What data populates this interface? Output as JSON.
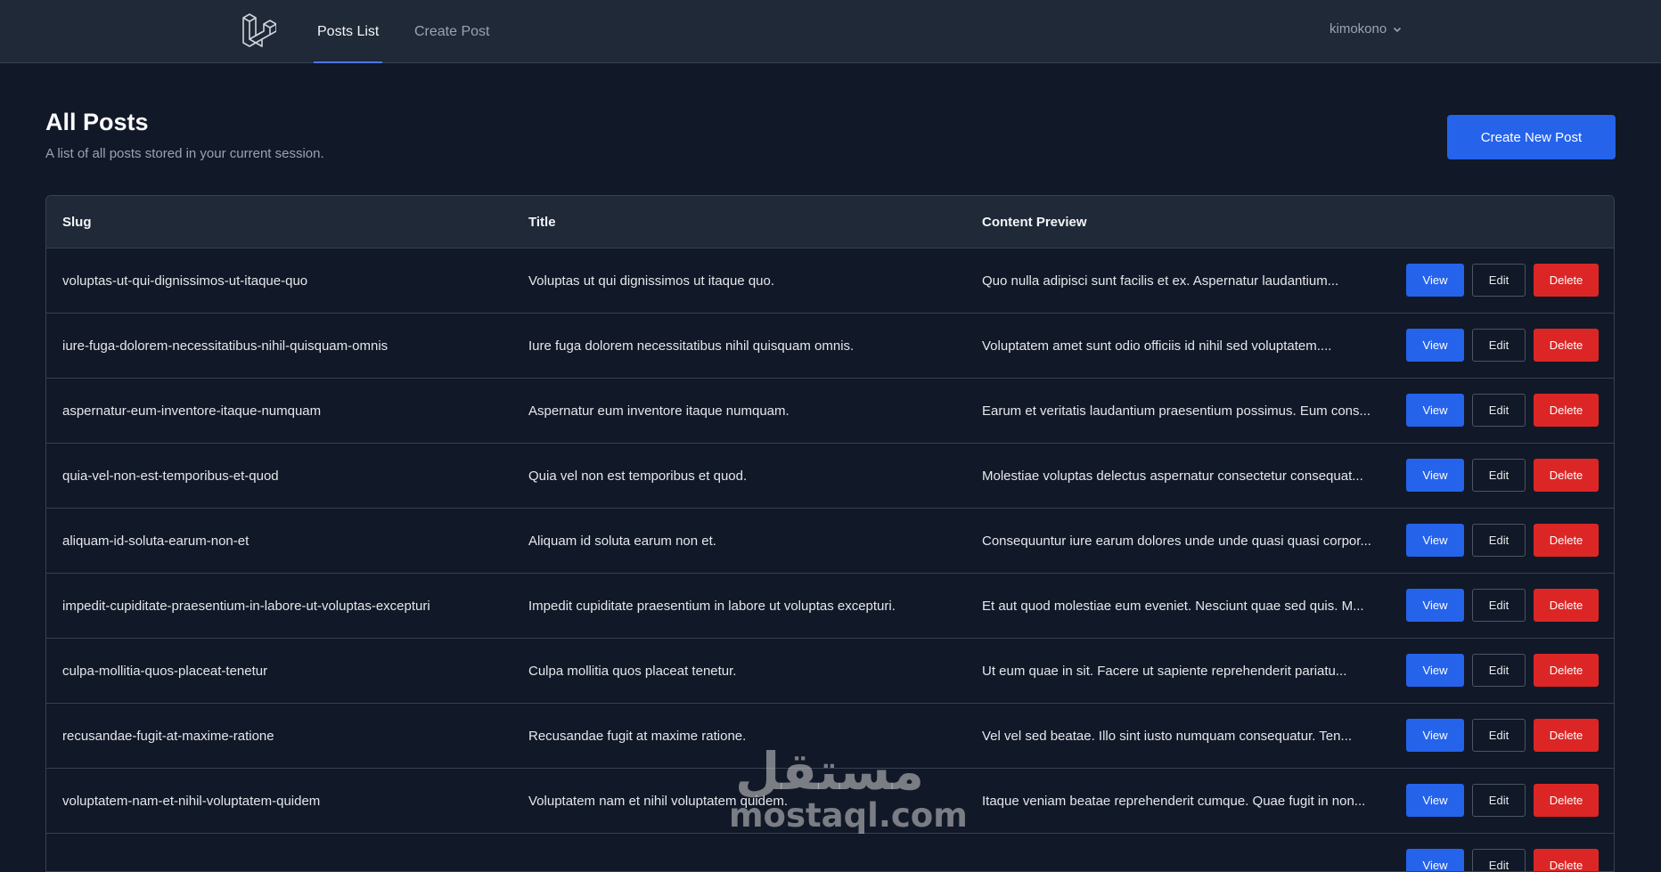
{
  "nav": {
    "tabs": [
      {
        "label": "Posts List"
      },
      {
        "label": "Create Post"
      }
    ],
    "user": "kimokono"
  },
  "header": {
    "title": "All Posts",
    "subtitle": "A list of all posts stored in your current session.",
    "create_button": "Create New Post"
  },
  "table": {
    "columns": [
      "Slug",
      "Title",
      "Content Preview"
    ],
    "actions": {
      "view": "View",
      "edit": "Edit",
      "delete": "Delete"
    },
    "rows": [
      {
        "slug": "voluptas-ut-qui-dignissimos-ut-itaque-quo",
        "title": "Voluptas ut qui dignissimos ut itaque quo.",
        "content": "Quo nulla adipisci sunt facilis et ex. Aspernatur laudantium..."
      },
      {
        "slug": "iure-fuga-dolorem-necessitatibus-nihil-quisquam-omnis",
        "title": "Iure fuga dolorem necessitatibus nihil quisquam omnis.",
        "content": "Voluptatem amet sunt odio officiis id nihil sed voluptatem...."
      },
      {
        "slug": "aspernatur-eum-inventore-itaque-numquam",
        "title": "Aspernatur eum inventore itaque numquam.",
        "content": "Earum et veritatis laudantium praesentium possimus. Eum cons..."
      },
      {
        "slug": "quia-vel-non-est-temporibus-et-quod",
        "title": "Quia vel non est temporibus et quod.",
        "content": "Molestiae voluptas delectus aspernatur consectetur consequat..."
      },
      {
        "slug": "aliquam-id-soluta-earum-non-et",
        "title": "Aliquam id soluta earum non et.",
        "content": "Consequuntur iure earum dolores unde unde quasi quasi corpor..."
      },
      {
        "slug": "impedit-cupiditate-praesentium-in-labore-ut-voluptas-excepturi",
        "title": "Impedit cupiditate praesentium in labore ut voluptas excepturi.",
        "content": "Et aut quod molestiae eum eveniet. Nesciunt quae sed quis. M..."
      },
      {
        "slug": "culpa-mollitia-quos-placeat-tenetur",
        "title": "Culpa mollitia quos placeat tenetur.",
        "content": "Ut eum quae in sit. Facere ut sapiente reprehenderit pariatu..."
      },
      {
        "slug": "recusandae-fugit-at-maxime-ratione",
        "title": "Recusandae fugit at maxime ratione.",
        "content": "Vel vel sed beatae. Illo sint iusto numquam consequatur. Ten..."
      },
      {
        "slug": "voluptatem-nam-et-nihil-voluptatem-quidem",
        "title": "Voluptatem nam et nihil voluptatem quidem.",
        "content": "Itaque veniam beatae reprehenderit cumque. Quae fugit in non..."
      },
      {
        "slug": "",
        "title": "",
        "content": ""
      }
    ]
  },
  "watermark": {
    "arabic": "مستقل",
    "latin": "mostaql.com"
  },
  "colors": {
    "background": "#111827",
    "navbar": "#1f2937",
    "primary": "#2563eb",
    "danger": "#dc2626"
  },
  "icons": {
    "logo": "laravel-logo-icon",
    "dropdown": "chevron-down-icon"
  }
}
